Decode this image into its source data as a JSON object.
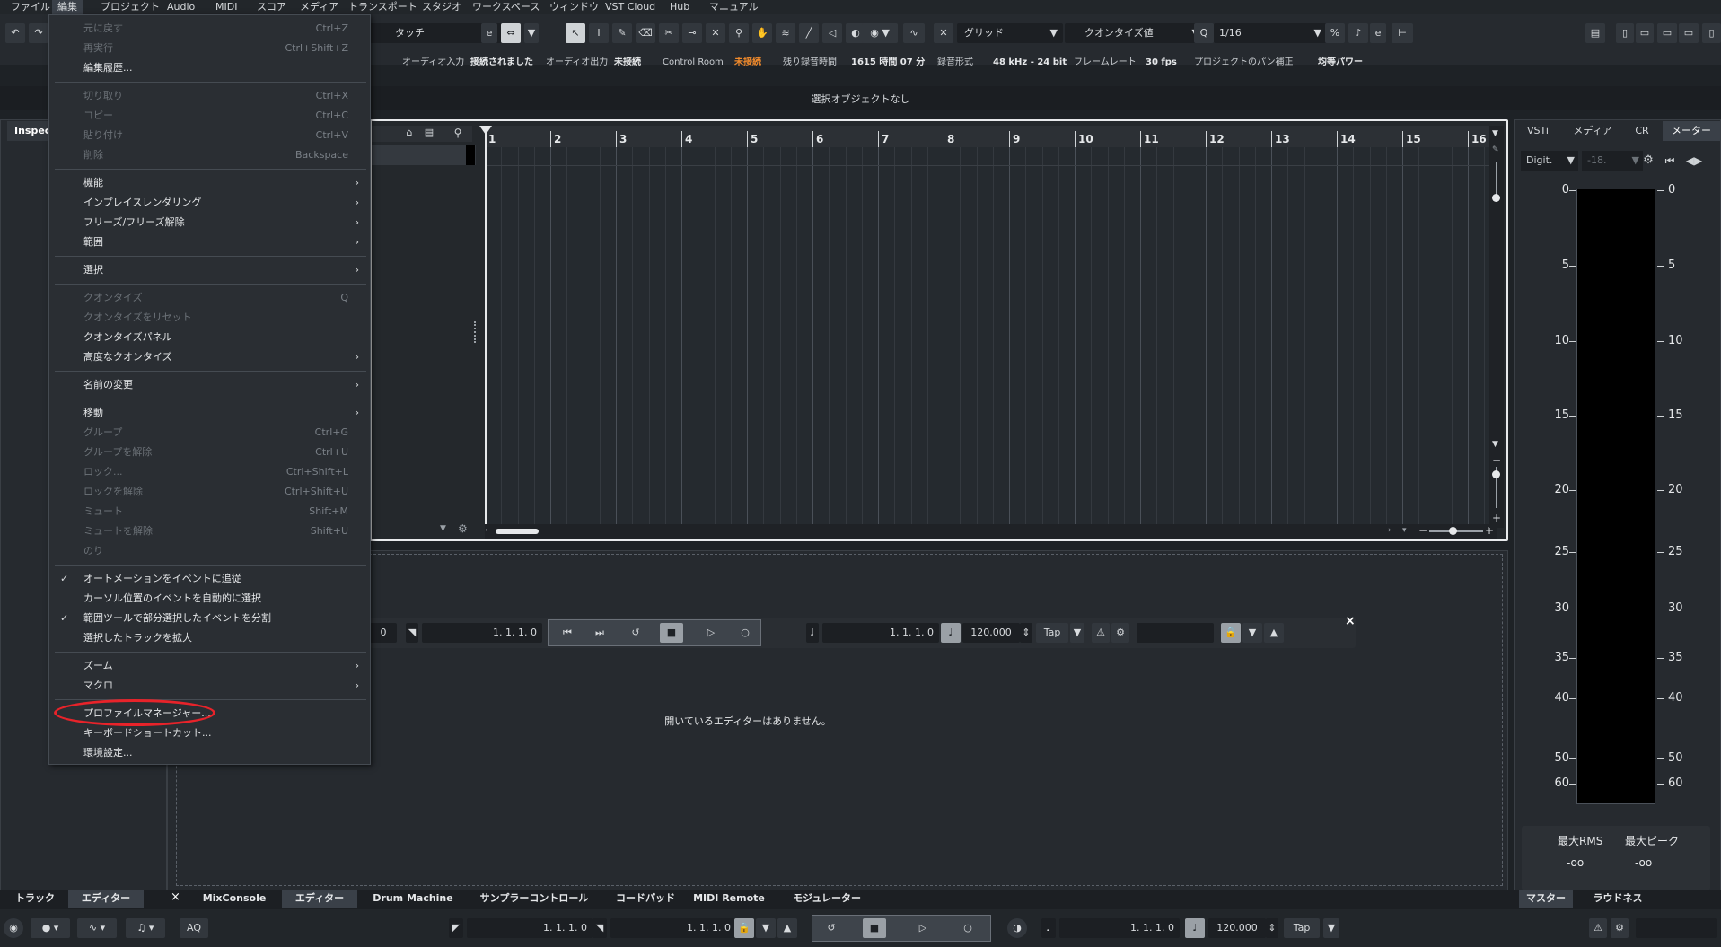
{
  "menubar": [
    "ファイル",
    "編集",
    "プロジェクト",
    "Audio",
    "MIDI",
    "スコア",
    "メディア",
    "トランスポート",
    "スタジオ",
    "ワークスペース",
    "ウィンドウ",
    "VST Cloud",
    "Hub",
    "マニュアル"
  ],
  "toolbar": {
    "automation_mode": "タッチ",
    "snap_type": "グリッド",
    "quantize_label": "クオンタイズ値",
    "quantize_value": "1/16"
  },
  "status": [
    {
      "label": "オーディオ入力",
      "value": "接続されました",
      "warn": false
    },
    {
      "label": "オーディオ出力",
      "value": "未接続",
      "warn": false
    },
    {
      "label": "Control Room",
      "value": "未接続",
      "warn": true
    },
    {
      "label": "残り録音時間",
      "value": "1615 時間 07 分",
      "warn": false
    },
    {
      "label": "録音形式",
      "value": "48 kHz - 24 bit",
      "warn": false
    },
    {
      "label": "フレームレート",
      "value": "30 fps",
      "warn": false
    },
    {
      "label": "プロジェクトのパン補正",
      "value": "均等パワー",
      "warn": false
    }
  ],
  "selection_info": "選択オブジェクトなし",
  "inspector_tab": "Inspect",
  "ruler": [
    "1",
    "2",
    "3",
    "4",
    "5",
    "6",
    "7",
    "8",
    "9",
    "10",
    "11",
    "12",
    "13",
    "14",
    "15",
    "16"
  ],
  "editor_empty": "開いているエディターはありません。",
  "transport": {
    "left_locator": "0",
    "position": "1. 1. 1.   0",
    "position2": "1. 1. 1.   0",
    "tempo": "120.000",
    "tap": "Tap"
  },
  "right_tabs": [
    "VSTi",
    "メディア",
    "CR",
    "メーター"
  ],
  "meter": {
    "mode": "Digit.",
    "ref": "-18.",
    "scale": [
      "0",
      "5",
      "10",
      "15",
      "20",
      "25",
      "30",
      "35",
      "40",
      "50",
      "60"
    ],
    "rms_label": "最大RMS",
    "peak_label": "最大ピーク",
    "rms_value": "-oo",
    "peak_value": "-oo"
  },
  "bottom_tabs_left": [
    "トラック",
    "エディター"
  ],
  "bottom_tabs_center": [
    "MixConsole",
    "エディター",
    "Drum Machine",
    "サンプラーコントロール",
    "コードパッド",
    "MIDI Remote",
    "モジュレーター"
  ],
  "bottom_tabs_right": [
    "マスター",
    "ラウドネス"
  ],
  "bottom_bar": {
    "aq": "AQ",
    "pos1": "1.  1.  1.   0",
    "pos2": "1.  1.  1.   0",
    "pos3": "1.  1.  1.   0",
    "tempo": "120.000",
    "tap": "Tap"
  },
  "edit_menu": [
    {
      "label": "元に戻す",
      "shortcut": "Ctrl+Z",
      "enabled": false
    },
    {
      "label": "再実行",
      "shortcut": "Ctrl+Shift+Z",
      "enabled": false
    },
    {
      "label": "編集履歴...",
      "shortcut": "",
      "enabled": true
    },
    {
      "label": "切り取り",
      "shortcut": "Ctrl+X",
      "enabled": false
    },
    {
      "label": "コピー",
      "shortcut": "Ctrl+C",
      "enabled": false
    },
    {
      "label": "貼り付け",
      "shortcut": "Ctrl+V",
      "enabled": false
    },
    {
      "label": "削除",
      "shortcut": "Backspace",
      "enabled": false
    },
    {
      "label": "機能",
      "submenu": true,
      "enabled": true
    },
    {
      "label": "インプレイスレンダリング",
      "submenu": true,
      "enabled": true
    },
    {
      "label": "フリーズ/フリーズ解除",
      "submenu": true,
      "enabled": true
    },
    {
      "label": "範囲",
      "submenu": true,
      "enabled": true
    },
    {
      "label": "選択",
      "submenu": true,
      "enabled": true
    },
    {
      "label": "クオンタイズ",
      "shortcut": "Q",
      "enabled": false
    },
    {
      "label": "クオンタイズをリセット",
      "shortcut": "",
      "enabled": false
    },
    {
      "label": "クオンタイズパネル",
      "shortcut": "",
      "enabled": true
    },
    {
      "label": "高度なクオンタイズ",
      "submenu": true,
      "enabled": true
    },
    {
      "label": "名前の変更",
      "submenu": true,
      "enabled": true
    },
    {
      "label": "移動",
      "submenu": true,
      "enabled": true
    },
    {
      "label": "グループ",
      "shortcut": "Ctrl+G",
      "enabled": false
    },
    {
      "label": "グループを解除",
      "shortcut": "Ctrl+U",
      "enabled": false
    },
    {
      "label": "ロック...",
      "shortcut": "Ctrl+Shift+L",
      "enabled": false
    },
    {
      "label": "ロックを解除",
      "shortcut": "Ctrl+Shift+U",
      "enabled": false
    },
    {
      "label": "ミュート",
      "shortcut": "Shift+M",
      "enabled": false
    },
    {
      "label": "ミュートを解除",
      "shortcut": "Shift+U",
      "enabled": false
    },
    {
      "label": "のり",
      "shortcut": "",
      "enabled": false
    },
    {
      "label": "オートメーションをイベントに追従",
      "checked": true,
      "enabled": true
    },
    {
      "label": "カーソル位置のイベントを自動的に選択",
      "checked": false,
      "enabled": true
    },
    {
      "label": "範囲ツールで部分選択したイベントを分割",
      "checked": true,
      "enabled": true
    },
    {
      "label": "選択したトラックを拡大",
      "checked": false,
      "enabled": true
    },
    {
      "label": "ズーム",
      "submenu": true,
      "enabled": true
    },
    {
      "label": "マクロ",
      "submenu": true,
      "enabled": true
    },
    {
      "label": "プロファイルマネージャー...",
      "enabled": true
    },
    {
      "label": "キーボードショートカット...",
      "enabled": true
    },
    {
      "label": "環境設定...",
      "enabled": true
    }
  ]
}
